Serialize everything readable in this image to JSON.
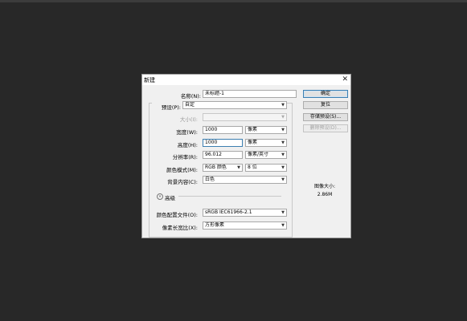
{
  "dialog": {
    "title": "新建",
    "close_glyph": "✕"
  },
  "fields": {
    "name": {
      "label": "名称(N):",
      "value": "未标题-1"
    },
    "preset": {
      "label": "预设(P):",
      "value": "自定"
    },
    "size": {
      "label": "大小(I):",
      "value": ""
    },
    "width": {
      "label": "宽度(W):",
      "value": "1000",
      "unit": "像素"
    },
    "height": {
      "label": "高度(H):",
      "value": "1000",
      "unit": "像素"
    },
    "resolution": {
      "label": "分辨率(R):",
      "value": "96.012",
      "unit": "像素/英寸"
    },
    "color_mode": {
      "label": "颜色模式(M):",
      "value": "RGB 颜色",
      "depth": "8 位"
    },
    "background": {
      "label": "背景内容(C):",
      "value": "白色"
    },
    "advanced_label": "高级",
    "advanced_toggle": "»",
    "color_profile": {
      "label": "颜色配置文件(O):",
      "value": "sRGB IEC61966-2.1"
    },
    "pixel_aspect": {
      "label": "像素长宽比(X):",
      "value": "方形像素"
    }
  },
  "buttons": {
    "ok": "确定",
    "reset": "复位",
    "save_preset": "存储预设(S)...",
    "delete_preset": "删除预设(D)..."
  },
  "image_size": {
    "title": "图像大小:",
    "value": "2.86M"
  },
  "icons": {
    "dropdown": "▼"
  }
}
